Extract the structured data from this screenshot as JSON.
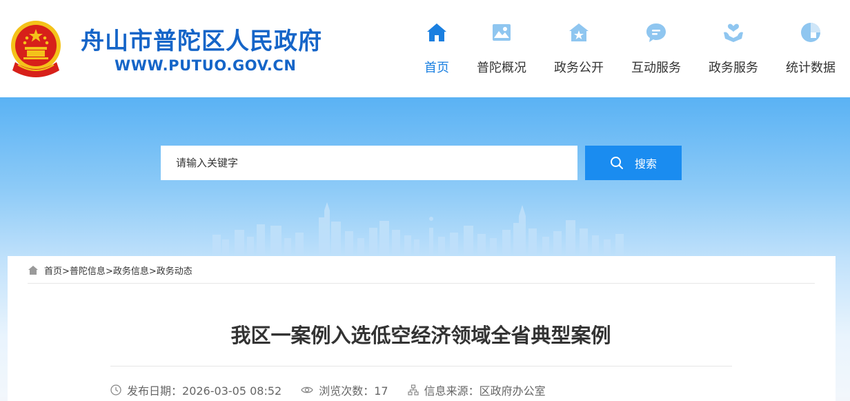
{
  "header": {
    "site_name": "舟山市普陀区人民政府",
    "site_url": "WWW.PUTUO.GOV.CN"
  },
  "nav": [
    {
      "label": "首页",
      "icon": "home-icon",
      "active": true
    },
    {
      "label": "普陀概况",
      "icon": "landscape-icon",
      "active": false
    },
    {
      "label": "政务公开",
      "icon": "government-icon",
      "active": false
    },
    {
      "label": "互动服务",
      "icon": "chat-icon",
      "active": false
    },
    {
      "label": "政务服务",
      "icon": "service-hands-icon",
      "active": false
    },
    {
      "label": "统计数据",
      "icon": "pie-chart-icon",
      "active": false
    }
  ],
  "search": {
    "placeholder": "请输入关键字",
    "button_label": "搜索"
  },
  "breadcrumb": [
    "首页",
    "普陀信息",
    "政务信息",
    "政务动态"
  ],
  "breadcrumb_separator": ">",
  "article": {
    "title": "我区一案例入选低空经济领域全省典型案例",
    "publish_label": "发布日期：",
    "publish_date": "2026-03-05 08:52",
    "views_label": "浏览次数：",
    "views": "17",
    "source_label": "信息来源：",
    "source": "区政府办公室"
  },
  "colors": {
    "brand": "#1565c8",
    "accent": "#1a8cf0",
    "nav_active": "#1a7fe0",
    "emblem_red": "#d7201a",
    "emblem_gold": "#f4c21a"
  }
}
